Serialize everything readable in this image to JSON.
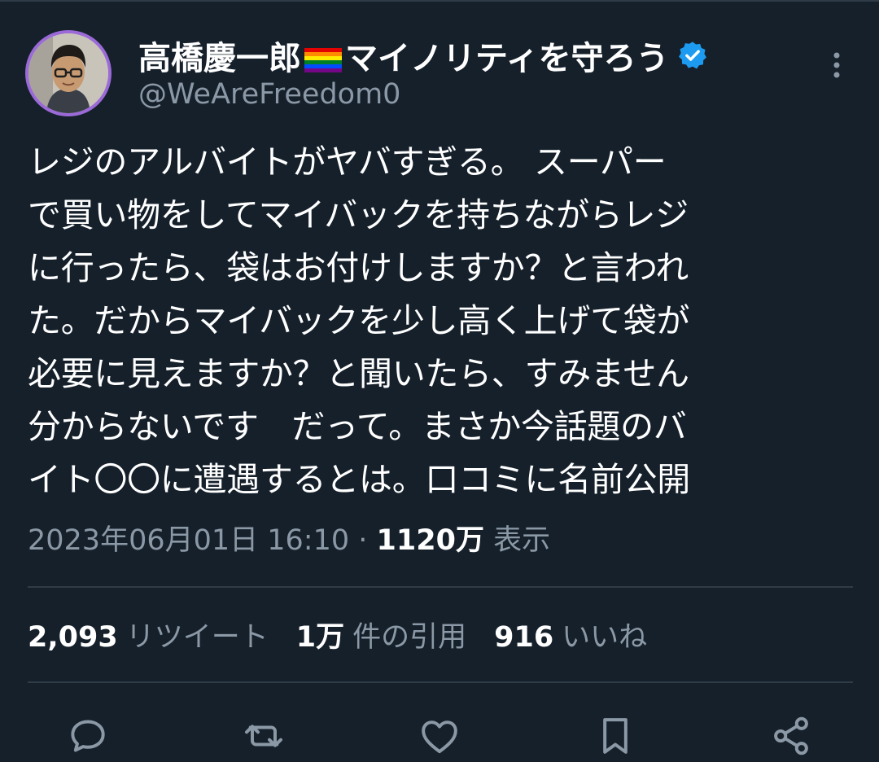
{
  "author": {
    "display_name_prefix": "高橋慶一郎",
    "display_name_suffix": "マイノリティを守ろう",
    "flag_icon": "rainbow-flag-icon",
    "verified_icon": "verified-badge-icon",
    "handle": "@WeAreFreedom0"
  },
  "tweet": {
    "lines": [
      "レジのアルバイトがヤバすぎる。 スーパー",
      "で買い物をしてマイバックを持ちながらレジ",
      "に行ったら、袋はお付けしますか？と言われ",
      "た。だからマイバックを少し高く上げて袋が",
      "必要に見えますか？と聞いたら、すみません",
      "分からないです　だって。まさか今話題のバ",
      "イト〇〇に遭遇するとは。口コミに名前公開"
    ],
    "timestamp": "2023年06月01日 16:10",
    "separator": " · ",
    "views_count": "1120万",
    "views_label": " 表示"
  },
  "stats": {
    "retweets_count": "2,093",
    "retweets_label": "リツイート",
    "quotes_count": "1万",
    "quotes_label": "件の引用",
    "likes_count": "916",
    "likes_label": "いいね"
  },
  "actions": [
    "reply-icon",
    "retweet-icon",
    "like-icon",
    "bookmark-icon",
    "share-icon"
  ],
  "colors": {
    "background": "#15202b",
    "text": "#ffffff",
    "secondary_text": "#8b98a5",
    "divider": "#2f3b47",
    "verified": "#1d9bf0",
    "avatar_ring": "#9b6ad8"
  }
}
